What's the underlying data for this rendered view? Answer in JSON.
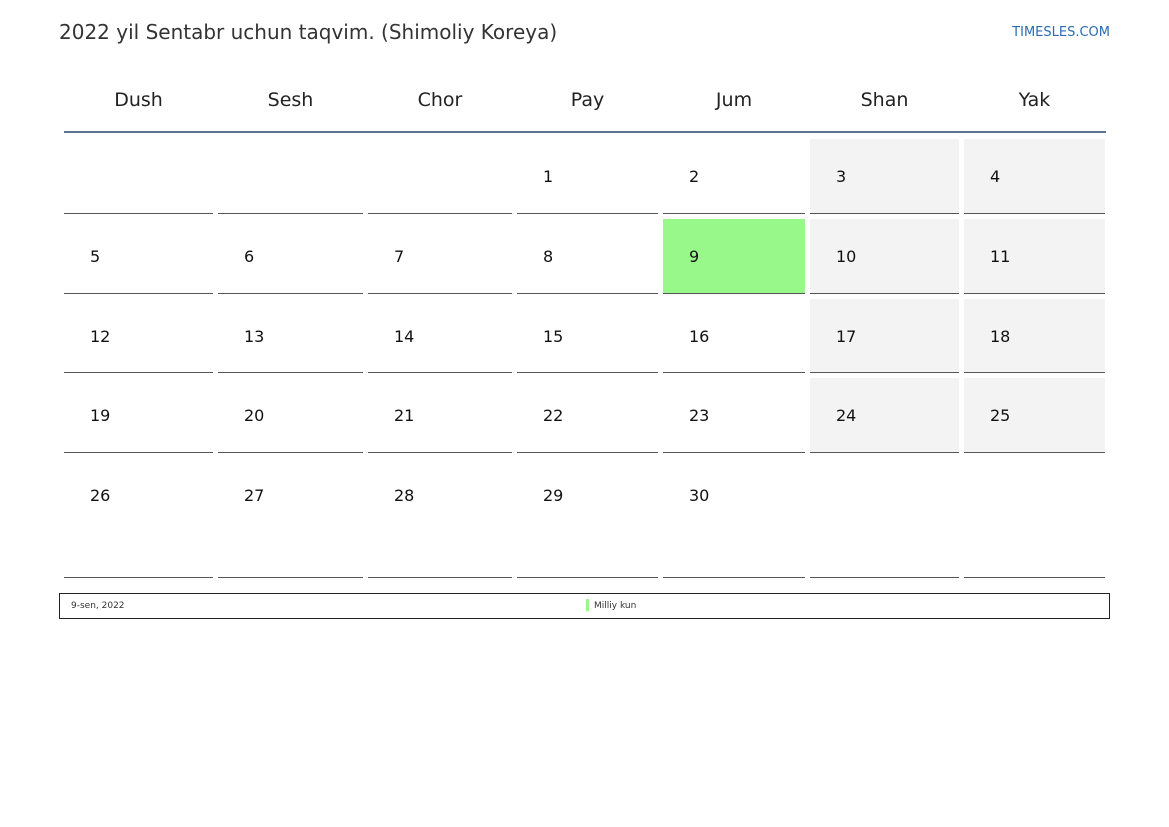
{
  "page": {
    "title": "2022 yil Sentabr uchun taqvim. (Shimoliy Koreya)",
    "brand": "TIMESLES.COM"
  },
  "weekdays": [
    "Dush",
    "Sesh",
    "Chor",
    "Pay",
    "Jum",
    "Shan",
    "Yak"
  ],
  "weeks": [
    [
      "",
      "",
      "",
      "1",
      "2",
      "3",
      "4"
    ],
    [
      "5",
      "6",
      "7",
      "8",
      "9",
      "10",
      "11"
    ],
    [
      "12",
      "13",
      "14",
      "15",
      "16",
      "17",
      "18"
    ],
    [
      "19",
      "20",
      "21",
      "22",
      "23",
      "24",
      "25"
    ],
    [
      "26",
      "27",
      "28",
      "29",
      "30",
      "",
      ""
    ]
  ],
  "holidays": [
    "9"
  ],
  "legend": {
    "date": "9-sen, 2022",
    "name": "Milliy kun"
  },
  "colors": {
    "holiday": "#99f88a",
    "weekend_bg": "#f3f3f3",
    "header_line": "#5b7590",
    "brand": "#2b6cb0"
  }
}
